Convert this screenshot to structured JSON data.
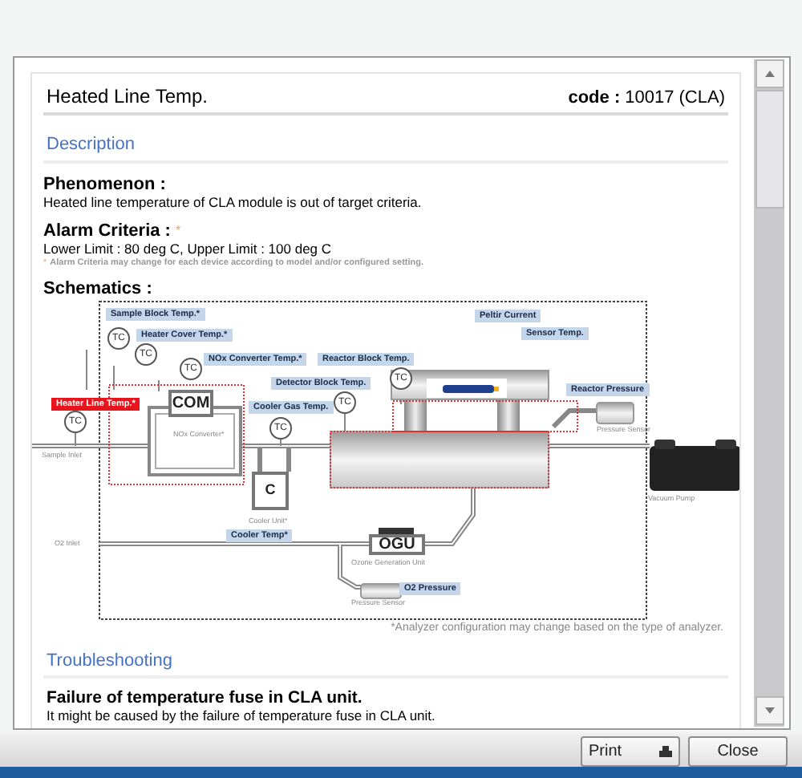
{
  "header": {
    "title": "Heated Line Temp.",
    "code_label": "code :",
    "code_value": "10017 (CLA)"
  },
  "description": {
    "heading": "Description",
    "phenomenon": {
      "label": "Phenomenon :",
      "text": "Heated line temperature of CLA module is out of target criteria."
    },
    "alarm": {
      "label": "Alarm Criteria :",
      "mark": "*",
      "text": "Lower Limit : 80 deg C, Upper Limit : 100 deg C",
      "note_mark": "*",
      "note": "Alarm Criteria may change for each device according to model and/or configured setting."
    },
    "schematics": {
      "label": "Schematics :",
      "labels": [
        {
          "text": "Sample Block Temp.*",
          "kind": "sensor"
        },
        {
          "text": "Heater Cover Temp.*",
          "kind": "sensor"
        },
        {
          "text": "NOx Converter Temp.*",
          "kind": "sensor"
        },
        {
          "text": "Reactor Block Temp.",
          "kind": "sensor"
        },
        {
          "text": "Detector Block Temp.",
          "kind": "sensor"
        },
        {
          "text": "Heater Line Temp.*",
          "kind": "alarm"
        },
        {
          "text": "Cooler Gas Temp.",
          "kind": "sensor"
        },
        {
          "text": "Peltir Current",
          "kind": "sensor"
        },
        {
          "text": "Sensor Temp.",
          "kind": "sensor"
        },
        {
          "text": "Reactor Pressure",
          "kind": "sensor"
        },
        {
          "text": "Cooler Temp*",
          "kind": "sensor"
        },
        {
          "text": "O2 Pressure",
          "kind": "sensor"
        }
      ],
      "tc_marks": [
        "TC",
        "TC",
        "TC",
        "TC",
        "TC",
        "TC",
        "TC"
      ],
      "units": [
        "COM",
        "C",
        "OGU"
      ],
      "captions": [
        "Sample Inlet",
        "NOx Converter*",
        "Cooler Unit*",
        "O2 Inlet",
        "Ozone Generation Unit",
        "Pressure Sensor",
        "Pressure Sensor",
        "Vacuum Pump"
      ],
      "note": "*Analyzer configuration may change based on the type of analyzer."
    }
  },
  "troubleshooting": {
    "heading": "Troubleshooting",
    "items": [
      {
        "title": "Failure of temperature fuse in CLA unit.",
        "text": "It might be caused by the failure of temperature fuse in CLA unit."
      }
    ]
  },
  "buttons": [
    {
      "label": "Print",
      "kind": "print"
    },
    {
      "label": "Close",
      "kind": "close"
    }
  ]
}
